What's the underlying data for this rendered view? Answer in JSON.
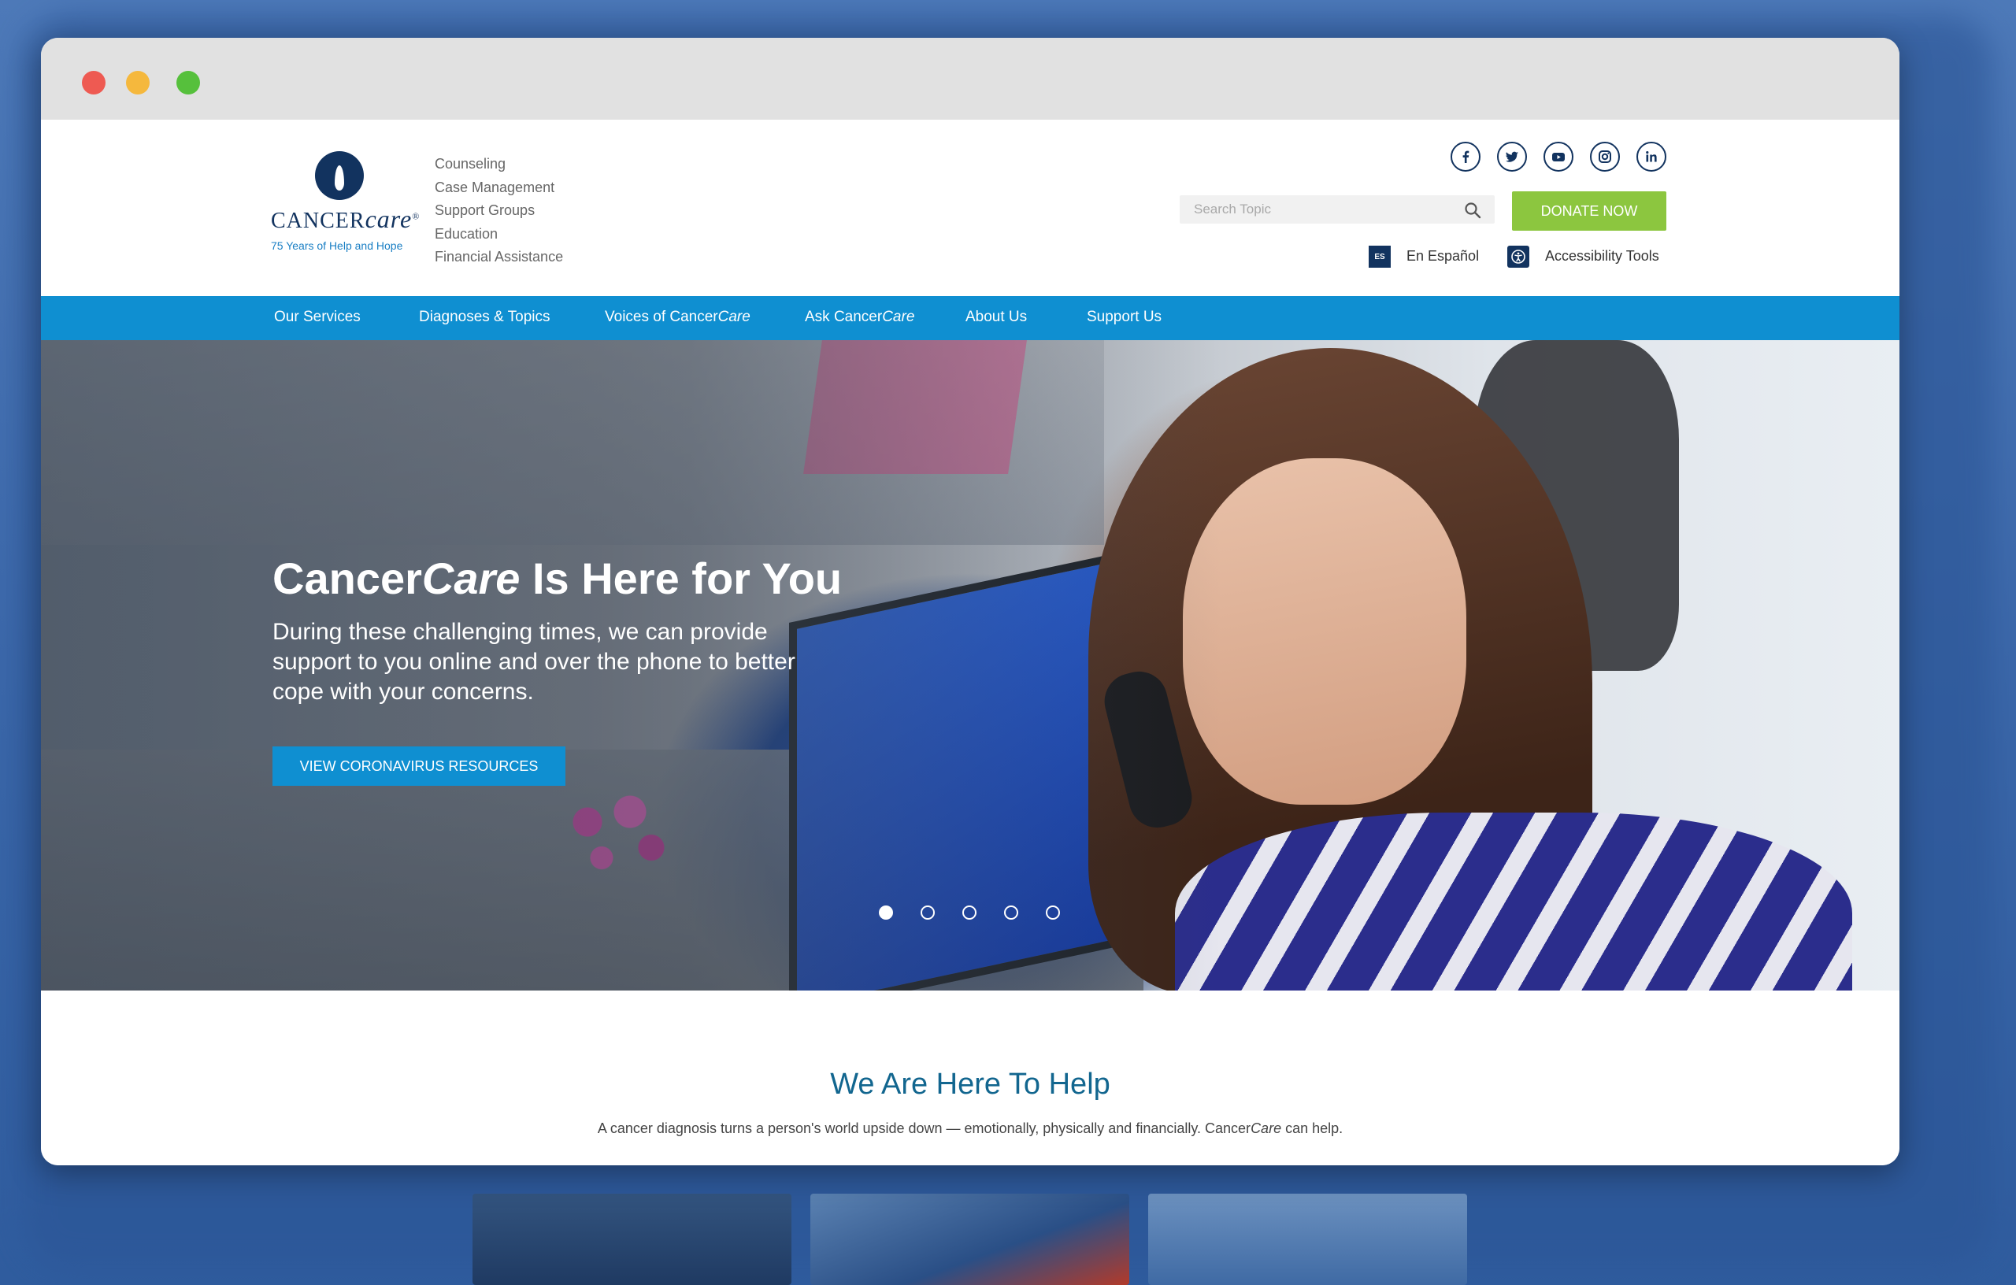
{
  "window": {
    "controls": [
      "close",
      "minimize",
      "maximize"
    ]
  },
  "header": {
    "logo": {
      "word_regular": "CANCER",
      "word_italic": "care",
      "registered": "®",
      "tagline": "75 Years of Help and Hope"
    },
    "services": [
      "Counseling",
      "Case Management",
      "Support Groups",
      "Education",
      "Financial Assistance"
    ],
    "social": [
      "facebook-icon",
      "twitter-icon",
      "youtube-icon",
      "instagram-icon",
      "linkedin-icon"
    ],
    "search_placeholder": "Search Topic",
    "donate_label": "DONATE NOW",
    "es_badge": "ES",
    "es_label": "En Español",
    "accessibility_label": "Accessibility Tools"
  },
  "nav": {
    "items": [
      {
        "pre": "Our Services",
        "italic": "",
        "post": ""
      },
      {
        "pre": "Diagnoses & Topics",
        "italic": "",
        "post": ""
      },
      {
        "pre": "Voices of Cancer",
        "italic": "Care",
        "post": ""
      },
      {
        "pre": "Ask Cancer",
        "italic": "Care",
        "post": ""
      },
      {
        "pre": "About Us",
        "italic": "",
        "post": ""
      },
      {
        "pre": "Support Us",
        "italic": "",
        "post": ""
      }
    ]
  },
  "hero": {
    "title_pre": "Cancer",
    "title_italic": "Care",
    "title_post": " Is Here for You",
    "subtitle": "During these challenging times, we can provide support to you online and over the phone to better cope with your concerns.",
    "button_label": "VIEW CORONAVIRUS RESOURCES",
    "slides_total": 5,
    "slide_active": 1
  },
  "help": {
    "title": "We Are Here To Help",
    "text_pre": "A cancer diagnosis turns a person's world upside down — emotionally, physically and financially. Cancer",
    "text_italic": "Care",
    "text_post": " can help."
  },
  "colors": {
    "brand_navy": "#12335f",
    "brand_blue": "#0f8fd1",
    "donate_green": "#8cc63f",
    "heading_teal": "#12668f"
  }
}
